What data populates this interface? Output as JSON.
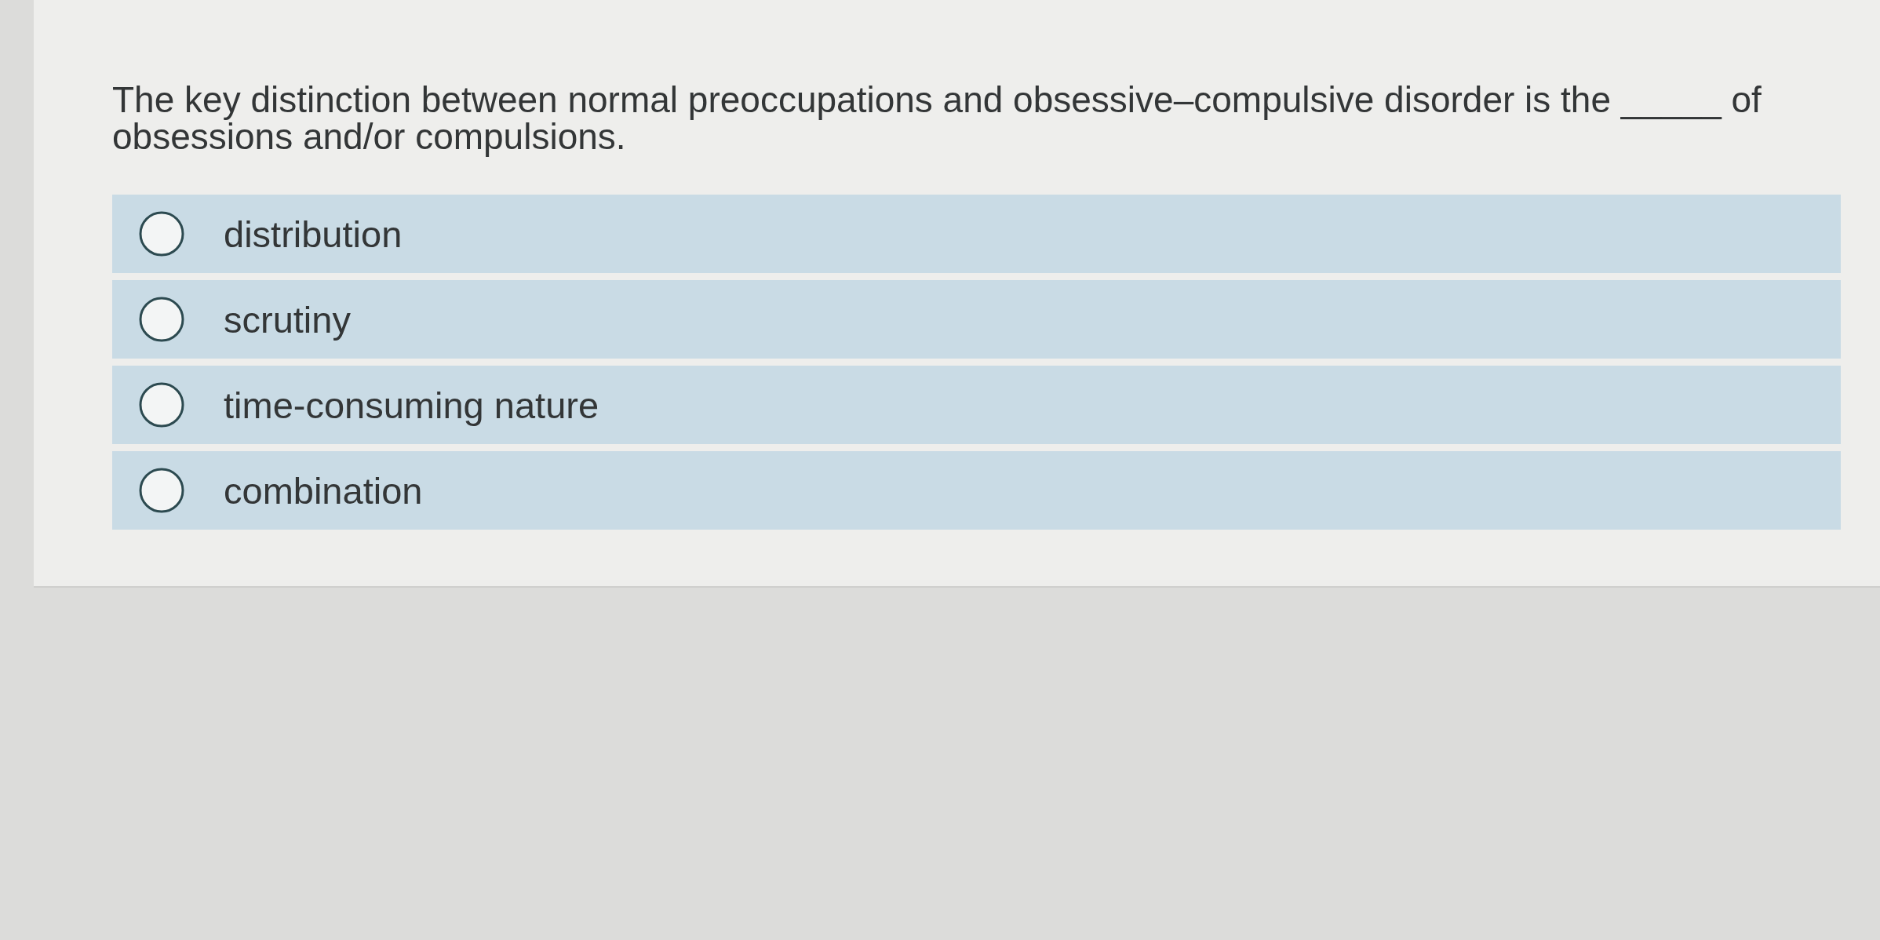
{
  "question": {
    "text": "The key distinction between normal preoccupations and obsessive–compulsive disorder is the _____ of obsessions and/or compulsions."
  },
  "options": [
    {
      "label": "distribution",
      "selected": false
    },
    {
      "label": "scrutiny",
      "selected": false
    },
    {
      "label": "time-consuming nature",
      "selected": false
    },
    {
      "label": "combination",
      "selected": false
    }
  ]
}
